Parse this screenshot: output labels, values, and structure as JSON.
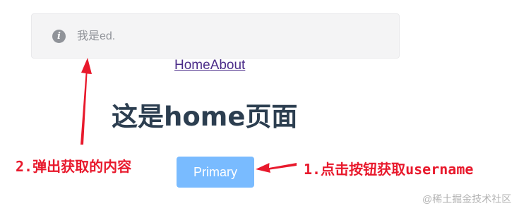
{
  "message": {
    "icon": "info-icon",
    "icon_glyph": "i",
    "text": "我是ed."
  },
  "nav": {
    "home_label": "Home",
    "about_label": "About"
  },
  "page": {
    "heading": "这是home页面"
  },
  "button": {
    "label": "Primary"
  },
  "annotations": {
    "left": "2.弹出获取的内容",
    "right": "1.点击按钮获取username"
  },
  "watermark": "@稀土掘金技术社区",
  "colors": {
    "annotation": "#e8192c",
    "button": "#79bbff",
    "heading": "#2c3e50",
    "link": "#4b2c89",
    "message_bg": "#f4f4f5"
  }
}
